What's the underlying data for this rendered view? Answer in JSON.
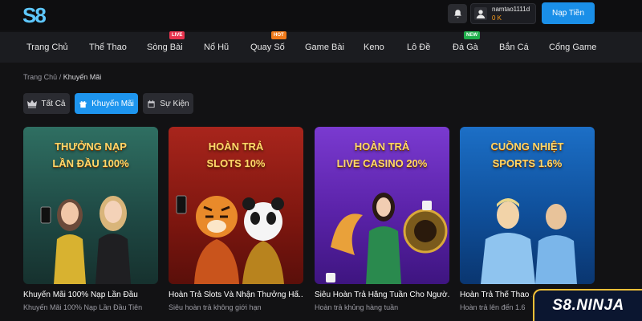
{
  "header": {
    "logo_text": "S8",
    "username": "namtao1111d",
    "balance": "0 K",
    "deposit_label": "Nạp Tiền"
  },
  "nav": {
    "items": [
      {
        "label": "Trang Chủ",
        "badge": ""
      },
      {
        "label": "Thể Thao",
        "badge": ""
      },
      {
        "label": "Sòng Bài",
        "badge": "LIVE"
      },
      {
        "label": "Nổ Hũ",
        "badge": ""
      },
      {
        "label": "Quay Số",
        "badge": "HOT"
      },
      {
        "label": "Game Bài",
        "badge": ""
      },
      {
        "label": "Keno",
        "badge": ""
      },
      {
        "label": "Lô Đề",
        "badge": ""
      },
      {
        "label": "Đá Gà",
        "badge": "NEW"
      },
      {
        "label": "Bắn Cá",
        "badge": ""
      },
      {
        "label": "Cổng Game",
        "badge": ""
      }
    ]
  },
  "breadcrumb": {
    "home": "Trang Chủ",
    "separator": "/",
    "current": "Khuyến Mãi"
  },
  "tabs": [
    {
      "label": "Tất Cả",
      "icon": "crown-icon",
      "active": false
    },
    {
      "label": "Khuyến Mãi",
      "icon": "gift-icon",
      "active": true
    },
    {
      "label": "Sự Kiện",
      "icon": "calendar-icon",
      "active": false
    }
  ],
  "promotions": [
    {
      "banner_line1": "THƯỞNG NẠP",
      "banner_line2": "LẦN ĐẦU 100%",
      "title": "Khuyến Mãi 100% Nạp Lần Đầu",
      "subtitle": "Khuyến Mãi 100% Nạp Lần Đầu Tiên"
    },
    {
      "banner_line1": "HOÀN TRẢ",
      "banner_line2": "SLOTS 10%",
      "title": "Hoàn Trả Slots Và Nhận Thưởng Hấ...",
      "subtitle": "Siêu hoàn trả không giới hạn"
    },
    {
      "banner_line1": "HOÀN TRẢ",
      "banner_line2": "LIVE CASINO 20%",
      "title": "Siêu Hoàn Trả Hằng Tuần Cho Ngườ...",
      "subtitle": "Hoàn trả khủng hàng tuần"
    },
    {
      "banner_line1": "CUỒNG NHIỆT",
      "banner_line2": "SPORTS 1.6%",
      "title": "Hoàn Trả Thể Thao 1",
      "subtitle": "Hoàn trả lên đến 1.6"
    }
  ],
  "watermark": "S8.NINJA",
  "colors": {
    "accent": "#1e95ee",
    "background": "#121214",
    "nav_bg": "#1b1c20",
    "badge_live": "#e8344e",
    "badge_hot": "#f07a1a",
    "badge_new": "#1fae4b"
  }
}
